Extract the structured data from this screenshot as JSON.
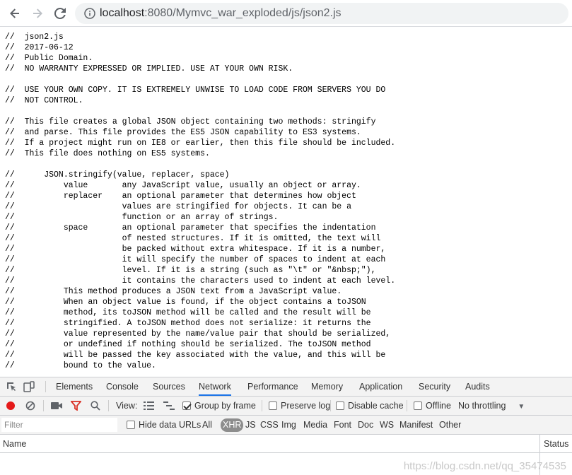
{
  "browser": {
    "url_host": "localhost",
    "url_rest": ":8080/Mymvc_war_exploded/js/json2.js"
  },
  "code_lines": [
    "//  json2.js",
    "//  2017-06-12",
    "//  Public Domain.",
    "//  NO WARRANTY EXPRESSED OR IMPLIED. USE AT YOUR OWN RISK.",
    "",
    "//  USE YOUR OWN COPY. IT IS EXTREMELY UNWISE TO LOAD CODE FROM SERVERS YOU DO",
    "//  NOT CONTROL.",
    "",
    "//  This file creates a global JSON object containing two methods: stringify",
    "//  and parse. This file provides the ES5 JSON capability to ES3 systems.",
    "//  If a project might run on IE8 or earlier, then this file should be included.",
    "//  This file does nothing on ES5 systems.",
    "",
    "//      JSON.stringify(value, replacer, space)",
    "//          value       any JavaScript value, usually an object or array.",
    "//          replacer    an optional parameter that determines how object",
    "//                      values are stringified for objects. It can be a",
    "//                      function or an array of strings.",
    "//          space       an optional parameter that specifies the indentation",
    "//                      of nested structures. If it is omitted, the text will",
    "//                      be packed without extra whitespace. If it is a number,",
    "//                      it will specify the number of spaces to indent at each",
    "//                      level. If it is a string (such as \"\\t\" or \"&nbsp;\"),",
    "//                      it contains the characters used to indent at each level.",
    "//          This method produces a JSON text from a JavaScript value.",
    "//          When an object value is found, if the object contains a toJSON",
    "//          method, its toJSON method will be called and the result will be",
    "//          stringified. A toJSON method does not serialize: it returns the",
    "//          value represented by the name/value pair that should be serialized,",
    "//          or undefined if nothing should be serialized. The toJSON method",
    "//          will be passed the key associated with the value, and this will be",
    "//          bound to the value."
  ],
  "devtools": {
    "tabs": [
      "Elements",
      "Console",
      "Sources",
      "Network",
      "Performance",
      "Memory",
      "Application",
      "Security",
      "Audits"
    ],
    "active_tab": "Network",
    "toolbar": {
      "view_label": "View:",
      "group_by_frame": "Group by frame",
      "preserve_log": "Preserve log",
      "disable_cache": "Disable cache",
      "offline": "Offline",
      "throttling": "No throttling"
    },
    "filter": {
      "placeholder": "Filter",
      "hide_data_urls": "Hide data URLs",
      "types": [
        "All",
        "XHR",
        "JS",
        "CSS",
        "Img",
        "Media",
        "Font",
        "Doc",
        "WS",
        "Manifest",
        "Other"
      ],
      "active_type": "XHR"
    },
    "columns": {
      "name": "Name",
      "status": "Status"
    }
  },
  "watermark": "https://blog.csdn.net/qq_35474535",
  "colors": {
    "record": "#e51a1a",
    "filter_icon": "#d93025",
    "active_tab_underline": "#1a73e8"
  }
}
